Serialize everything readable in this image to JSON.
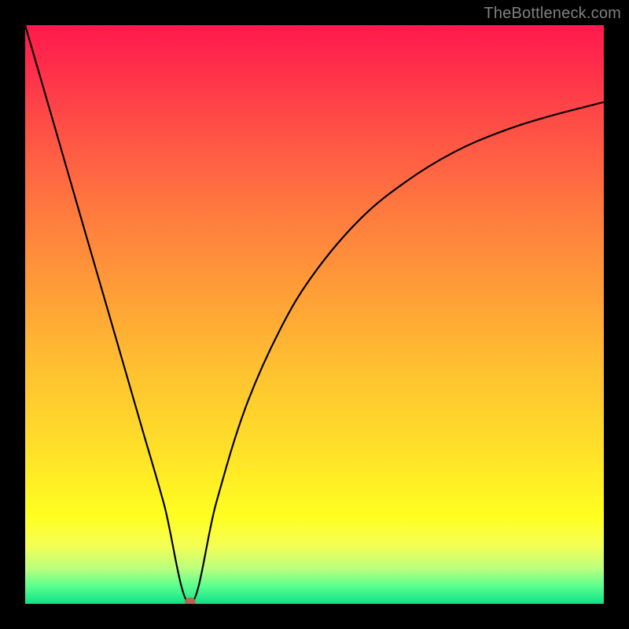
{
  "watermark": "TheBottleneck.com",
  "theme": {
    "frame_border": "#000000",
    "curve_color": "#000000",
    "dot_color": "#c0604c",
    "gradient_top": "#ff1a4d",
    "gradient_mid": "#ffe428",
    "gradient_bottom": "#11e086"
  },
  "chart_data": {
    "type": "line",
    "title": "",
    "xlabel": "",
    "ylabel": "",
    "xlim": [
      0,
      100
    ],
    "ylim": [
      0,
      100
    ],
    "grid": false,
    "legend": false,
    "series": [
      {
        "name": "bottleneck-curve",
        "notes": "V-shaped curve. Minimum at x≈28.5, y≈0. Left branch descends from top-left corner. Right branch rises and flattens toward upper-right.",
        "x": [
          0,
          5,
          10,
          15,
          20,
          24,
          28.5,
          33,
          38,
          44,
          50,
          58,
          66,
          74,
          82,
          90,
          100
        ],
        "y": [
          100,
          82.8,
          65.5,
          48.3,
          31.0,
          17.2,
          0,
          17.4,
          33.7,
          47.3,
          57.2,
          66.6,
          73.1,
          78.0,
          81.5,
          84.1,
          86.7
        ]
      }
    ],
    "marker": {
      "x": 28.5,
      "y": 0
    }
  }
}
